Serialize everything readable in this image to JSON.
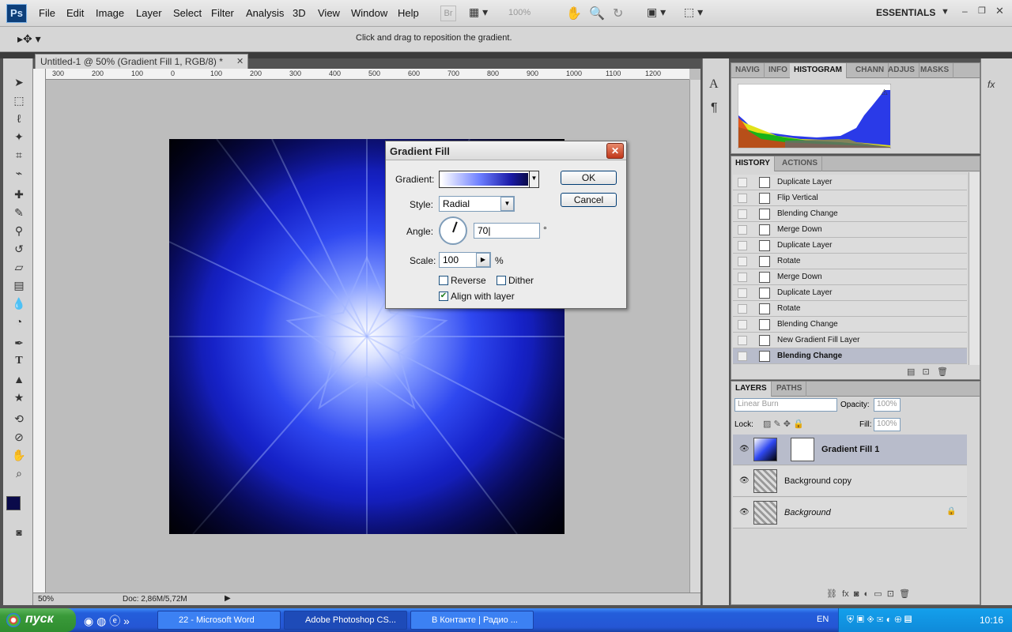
{
  "app": {
    "logo": "Ps",
    "menu": [
      "File",
      "Edit",
      "Image",
      "Layer",
      "Select",
      "Filter",
      "Analysis",
      "3D",
      "View",
      "Window",
      "Help"
    ],
    "toolbar": {
      "bridge": "Br",
      "zoom": "100%"
    },
    "workspace": "ESSENTIALS"
  },
  "options_bar": {
    "hint": "Click and drag to reposition the gradient."
  },
  "document": {
    "tab_title": "Untitled-1 @ 50% (Gradient Fill 1, RGB/8) *",
    "ruler_h": [
      "300",
      "200",
      "100",
      "0",
      "100",
      "200",
      "300",
      "400",
      "500",
      "600",
      "700",
      "800",
      "900",
      "1000",
      "1100",
      "1200"
    ],
    "zoom": "50%",
    "doc_size": "Doc: 2,86M/5,72M"
  },
  "dialog": {
    "title": "Gradient Fill",
    "gradient_label": "Gradient:",
    "style_label": "Style:",
    "style_value": "Radial",
    "angle_label": "Angle:",
    "angle_value": "70",
    "angle_unit": "°",
    "scale_label": "Scale:",
    "scale_value": "100",
    "scale_unit": "%",
    "reverse_label": "Reverse",
    "dither_label": "Dither",
    "align_label": "Align with layer",
    "ok": "OK",
    "cancel": "Cancel"
  },
  "histogram_panel": {
    "tabs": [
      "NAVIG",
      "INFO",
      "HISTOGRAM",
      "CHANN",
      "ADJUS",
      "MASKS"
    ]
  },
  "history_panel": {
    "tabs": [
      "HISTORY",
      "ACTIONS"
    ],
    "items": [
      "Duplicate Layer",
      "Flip Vertical",
      "Blending Change",
      "Merge Down",
      "Duplicate Layer",
      "Rotate",
      "Merge Down",
      "Duplicate Layer",
      "Rotate",
      "Blending Change",
      "New Gradient Fill Layer",
      "Blending Change"
    ]
  },
  "layers_panel": {
    "tabs": [
      "LAYERS",
      "PATHS"
    ],
    "blend_mode": "Linear Burn",
    "opacity_label": "Opacity:",
    "opacity": "100%",
    "lock_label": "Lock:",
    "fill_label": "Fill:",
    "fill": "100%",
    "layers": [
      "Gradient Fill 1",
      "Background copy",
      "Background"
    ]
  },
  "taskbar": {
    "start": "пуск",
    "tasks": [
      "22 - Microsoft Word",
      "Adobe Photoshop CS...",
      "В Контакте | Радио ..."
    ],
    "lang": "EN",
    "time": "10:16"
  },
  "colors": {
    "accent": "#1a1aa6",
    "foreground": "#0a0a4a",
    "selection": "#b8bccb"
  }
}
